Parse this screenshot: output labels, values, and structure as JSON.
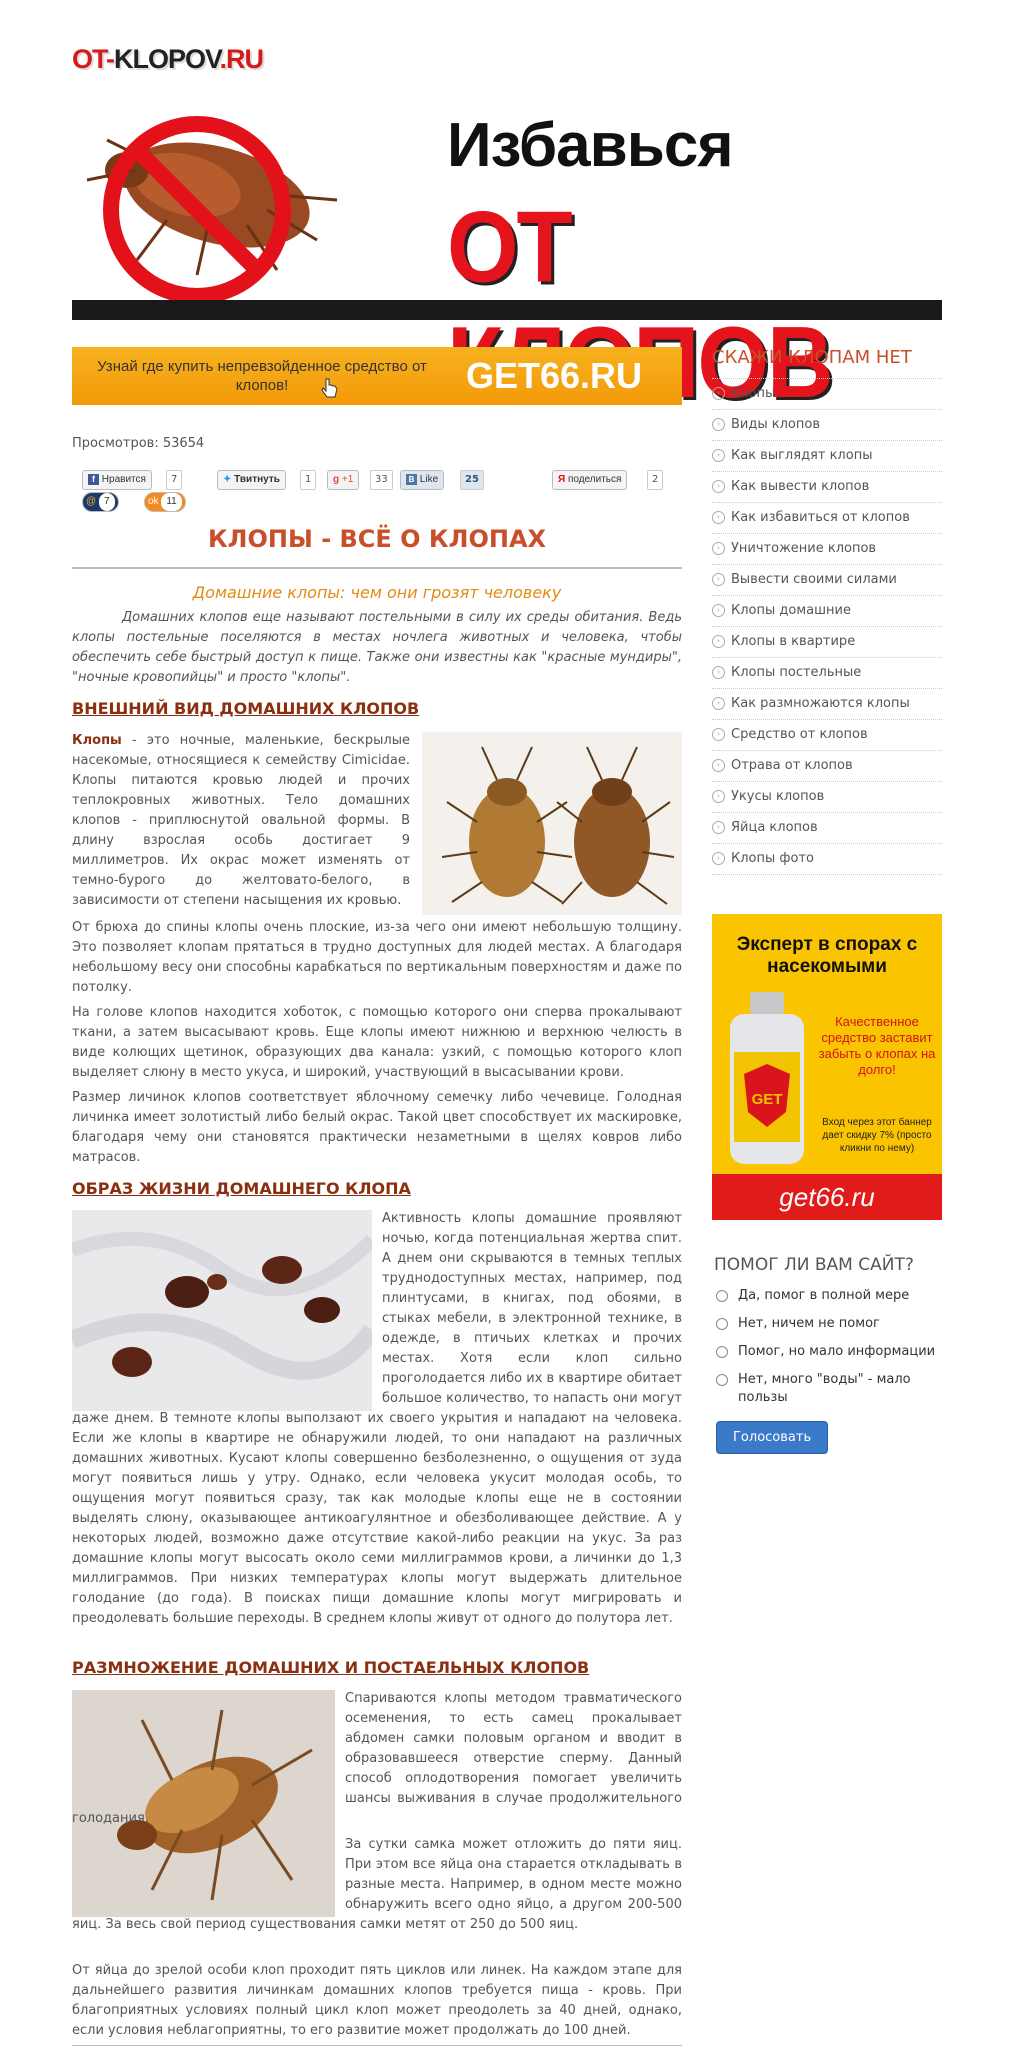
{
  "header": {
    "logo_part1": "OT-",
    "logo_part2": "KLOPOV",
    "logo_part3": ".RU",
    "banner_line1": "Избавься",
    "banner_line2": "ОТ КЛОПОВ"
  },
  "top_ad": {
    "text": "Узнай где купить непревзойденное средство от клопов!",
    "domain": "GET66.RU"
  },
  "views_text": "Просмотров: 53654",
  "social": {
    "fb_label": "Нравится",
    "fb_count": "7",
    "tw_label": "Твитнуть",
    "tw_count": "1",
    "gp_label": "+1",
    "gp_count": "33",
    "vk_label": "Like",
    "vk_count": "25",
    "ya_label": "поделиться",
    "ya_count": "2",
    "mail_count": "7",
    "ok_count": "11"
  },
  "article": {
    "title": "КЛОПЫ - ВСЁ О КЛОПАХ",
    "subtitle": "Домашние клопы: чем они грозят человеку",
    "intro": "Домашних клопов еще называют постельными в силу их среды обитания. Ведь клопы постельные поселяются в местах ночлега животных и человека, чтобы обеспечить себе быстрый доступ к пище. Также они известны как \"красные мундиры\", \"ночные кровопийцы\" и просто \"клопы\".",
    "s1_title": "ВНЕШНИЙ ВИД ДОМАШНИХ КЛОПОВ",
    "s1_bold": "Клопы",
    "s1_p1": " - это ночные, маленькие, бескрылые насекомые, относящиеся к семейству Cimicidae. Клопы питаются кровью людей и прочих теплокровных животных. Тело домашних клопов - приплюснутой овальной формы. В длину взрослая особь достигает 9 миллиметров. Их окрас может изменять от темно-бурого до желтовато-белого, в зависимости от степени насыщения их кровью.",
    "s1_p2": "От брюха до спины клопы очень плоские, из-за чего они имеют небольшую толщину. Это позволяет клопам прятаться в трудно доступных для людей местах. А благодаря небольшому весу они способны карабкаться по вертикальным поверхностям и даже по потолку.",
    "s1_p3": "На голове клопов находится хоботок, с помощью которого они сперва прокалывают ткани, а затем высасывают кровь. Еще клопы имеют нижнюю и верхнюю челюсть в виде колющих щетинок, образующих два канала: узкий, с помощью которого клоп выделяет слюну в место укуса, и широкий, участвующий в высасывании крови.",
    "s1_p4": "Размер личинок клопов соответствует яблочному семечку либо чечевице. Голодная личинка имеет золотистый либо белый окрас. Такой цвет способствует их маскировке, благодаря чему они становятся практически незаметными в щелях ковров либо матрасов.",
    "s2_title": "ОБРАЗ ЖИЗНИ ДОМАШНЕГО КЛОПА",
    "s2_p1": "Активность клопы домашние проявляют ночью, когда потенциальная жертва спит. А днем они скрываются в темных теплых труднодоступных местах, например, под плинтусами, в книгах, под обоями, в стыках мебели, в электронной технике, в одежде, в птичьих клетках и прочих местах. Хотя если клоп сильно проголодается либо их в квартире обитает большое количество, то напасть они могут даже днем. В темноте клопы выползают их своего укрытия и нападают на человека. Если же клопы в квартире не обнаружили людей, то они нападают на различных домашних животных. Кусают клопы совершенно безболезненно, о ощущения от зуда могут появиться лишь у утру. Однако, если человека укусит молодая особь, то ощущения могут появиться сразу, так как молодые клопы еще не в состоянии выделять слюну, оказывающее антикоагулянтное и обезболивающее действие. А у некоторых людей, возможно даже отсутствие какой-либо реакции на укус. За раз домашние клопы могут высосать около семи миллиграммов крови, а личинки до 1,3 миллиграммов. При низких температурах клопы могут выдержать длительное голодание (до года). В поисках пищи домашние клопы могут мигрировать и преодолевать большие переходы. В среднем клопы живут от одного до полутора лет.",
    "s3_title": "РАЗМНОЖЕНИЕ ДОМАШНИХ И ПОСТАЕЛЬНЫХ КЛОПОВ",
    "s3_p1": "Спариваются клопы методом травматического осеменения, то есть самец прокалывает абдомен самки половым органом и вводит в образовавшееся отверстие сперму. Данный способ оплодотворения помогает увеличить шансы выживания в случае продолжительного голодания.",
    "s3_p2": "За сутки самка может отложить до пяти яиц. При этом все яйца она старается откладывать в разные места. Например, в одном месте можно обнаружить всего одно яйцо, а другом 200-500 яиц. За весь свой период существования самки метят от 250 до 500 яиц.",
    "s3_p3": "От яйца до зрелой особи клоп проходит пять циклов или линек. На каждом этапе для дальнейшего развития личинкам домашних клопов требуется пища - кровь. При благоприятных условиях полный цикл клоп может преодолеть за 40 дней, однако, если условия неблагоприятны, то его развитие может продолжать до 100 дней."
  },
  "sidebar": {
    "title": "СКАЖИ КЛОПАМ НЕТ",
    "items": [
      "Клопы",
      "Виды клопов",
      "Как выглядят клопы",
      "Как вывести клопов",
      "Как избавиться от клопов",
      "Уничтожение клопов",
      "Вывести своими силами",
      "Клопы домашние",
      "Клопы в квартире",
      "Клопы постельные",
      "Как размножаются клопы",
      "Средство от клопов",
      "Отрава от клопов",
      "Укусы клопов",
      "Яйца клопов",
      "Клопы фото"
    ]
  },
  "side_ad": {
    "headline": "Эксперт в спорах с насекомыми",
    "red_text": "Качественное средство заставит забыть о клопах на долго!",
    "small_text": "Вход через этот баннер дает скидку 7% (просто кликни по нему)",
    "bottle_label": "GET",
    "footer": "get66.ru"
  },
  "poll": {
    "question": "ПОМОГ ЛИ ВАМ САЙТ?",
    "options": [
      "Да, помог в полной мере",
      "Нет, ничем не помог",
      "Помог, но мало информации",
      "Нет, много \"воды\" - мало пользы"
    ],
    "button": "Голосовать"
  },
  "colors": {
    "accent_red": "#c84f2a",
    "section_heading": "#8a3010",
    "subtitle_orange": "#e58a17",
    "ad_orange": "#f7b11e",
    "ad_yellow": "#fbc400",
    "button_blue": "#3b79c9"
  }
}
